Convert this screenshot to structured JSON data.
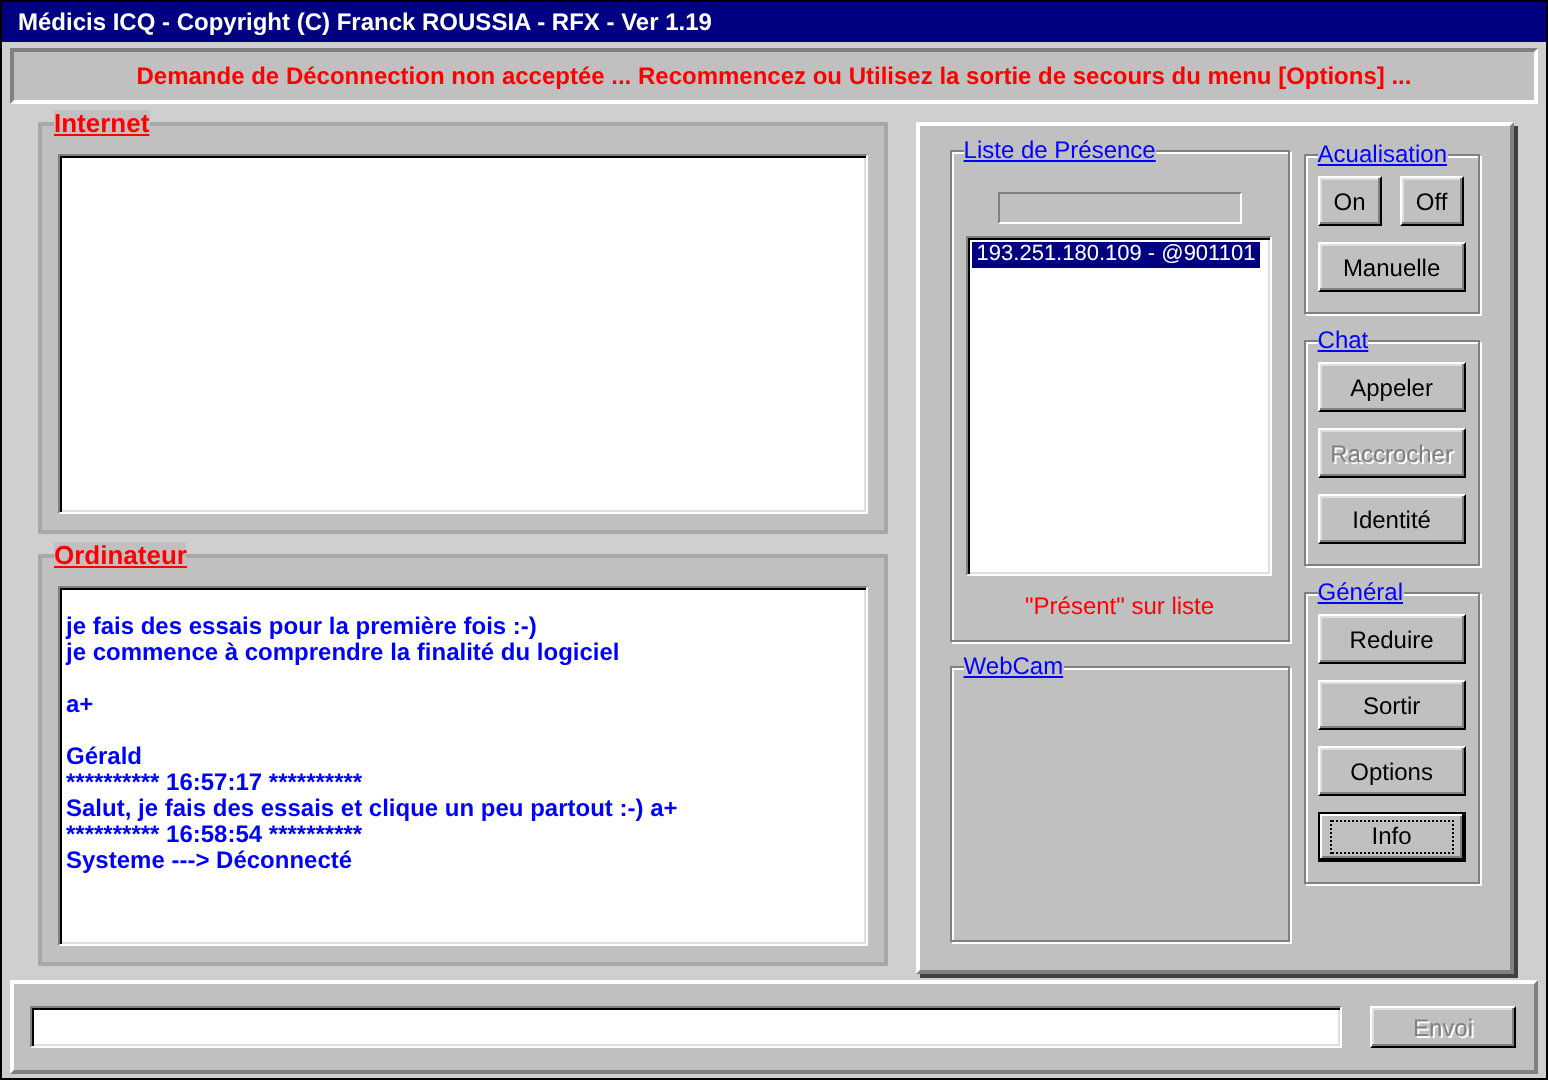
{
  "window": {
    "title": "Médicis ICQ - Copyright (C)  Franck ROUSSIA - RFX - Ver 1.19"
  },
  "status_message": "Demande de Déconnection non acceptée ... Recommencez ou Utilisez la sortie de secours du menu [Options] ...",
  "internet_group": {
    "title": "Internet"
  },
  "ordinateur_group": {
    "title": "Ordinateur",
    "paragraphs": [
      [
        "je fais des essais pour la première fois :-)",
        "je commence à comprendre la finalité du logiciel"
      ],
      [
        "a+"
      ],
      [
        "Gérald",
        "********** 16:57:17 **********",
        "Salut, je fais des essais et clique un peu partout :-) a+",
        "********** 16:58:54 **********",
        "Systeme ---> Déconnecté"
      ]
    ]
  },
  "presence": {
    "title": "Liste de Présence",
    "items": [
      {
        "label": "193.251.180.109 - @901101",
        "selected": true
      }
    ],
    "note": "\"Présent\" sur liste"
  },
  "webcam": {
    "title": "WebCam"
  },
  "groups": [
    {
      "title": "Acualisation",
      "buttons": [
        {
          "label": "On",
          "kind": "small",
          "disabled": false,
          "focused": false
        },
        {
          "label": "Off",
          "kind": "small",
          "disabled": false,
          "focused": false
        },
        {
          "label": "Manuelle",
          "kind": "wide",
          "disabled": false,
          "focused": false
        }
      ]
    },
    {
      "title": "Chat",
      "buttons": [
        {
          "label": "Appeler",
          "kind": "wide",
          "disabled": false,
          "focused": false
        },
        {
          "label": "Raccrocher",
          "kind": "wide",
          "disabled": true,
          "focused": false
        },
        {
          "label": "Identité",
          "kind": "wide",
          "disabled": false,
          "focused": false
        }
      ]
    },
    {
      "title": "Général",
      "buttons": [
        {
          "label": "Reduire",
          "kind": "wide",
          "disabled": false,
          "focused": false
        },
        {
          "label": "Sortir",
          "kind": "wide",
          "disabled": false,
          "focused": false
        },
        {
          "label": "Options",
          "kind": "wide",
          "disabled": false,
          "focused": false
        },
        {
          "label": "Info",
          "kind": "wide",
          "disabled": false,
          "focused": true
        }
      ]
    }
  ],
  "send_button": {
    "label": "Envoi",
    "disabled": true
  }
}
